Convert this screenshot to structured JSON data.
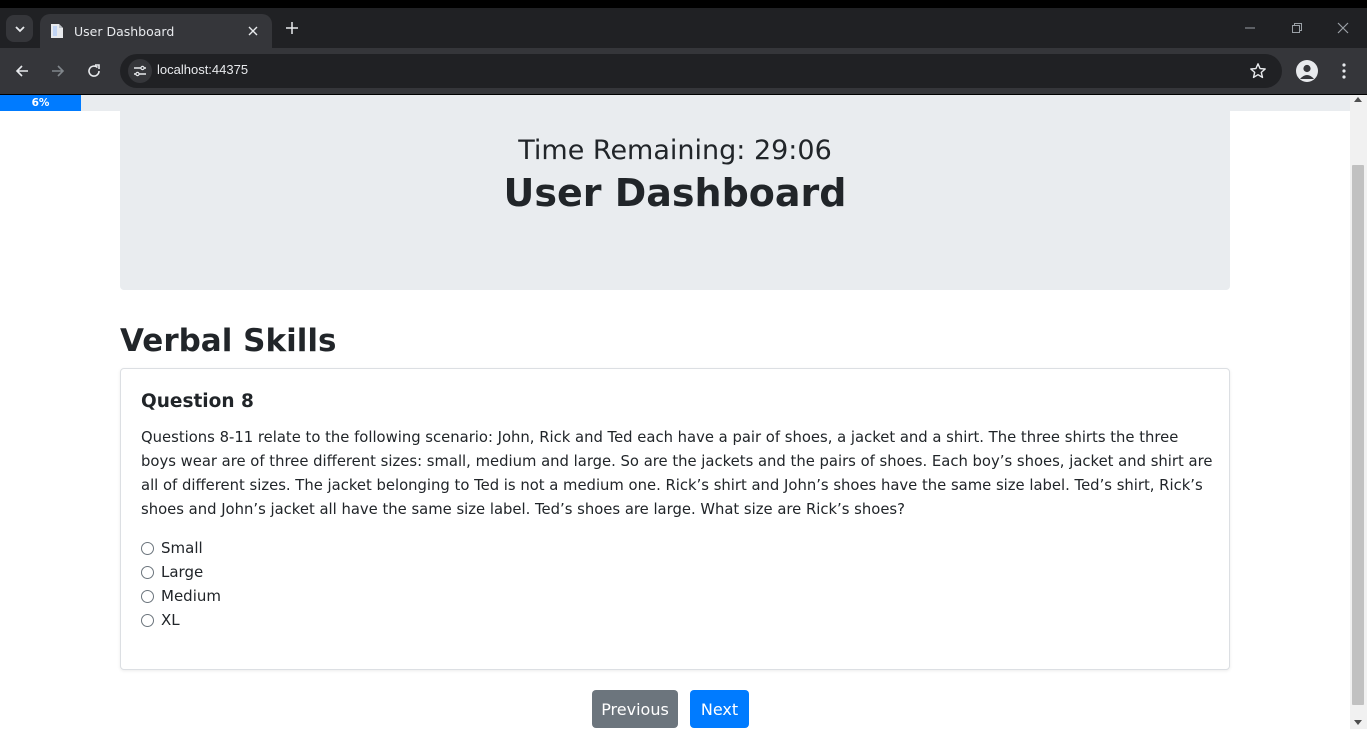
{
  "browser": {
    "tab_title": "User Dashboard",
    "url": "localhost:44375"
  },
  "page": {
    "progress": {
      "label": "6%",
      "value_percent": 6
    },
    "header": {
      "timer": "Time Remaining: 29:06",
      "title": "User Dashboard"
    },
    "section_title": "Verbal Skills",
    "question": {
      "title": "Question 8",
      "text": "Questions 8-11 relate to the following scenario: John, Rick and Ted each have a pair of shoes, a jacket and a shirt. The three shirts the three boys wear are of three different sizes: small, medium and large. So are the jackets and the pairs of shoes. Each boy’s shoes, jacket and shirt are all of different sizes. The jacket belonging to Ted is not a medium one. Rick’s shirt and John’s shoes have the same size label. Ted’s shirt, Rick’s shoes and John’s jacket all have the same size label. Ted’s shoes are large. What size are Rick’s shoes?",
      "options": [
        {
          "label": "Small"
        },
        {
          "label": "Large"
        },
        {
          "label": "Medium"
        },
        {
          "label": "XL"
        }
      ]
    },
    "buttons": {
      "previous": "Previous",
      "next": "Next"
    }
  },
  "colors": {
    "primary": "#007bff",
    "secondary": "#6c757d",
    "jumbotron_bg": "#e9ecef",
    "text": "#212529"
  }
}
